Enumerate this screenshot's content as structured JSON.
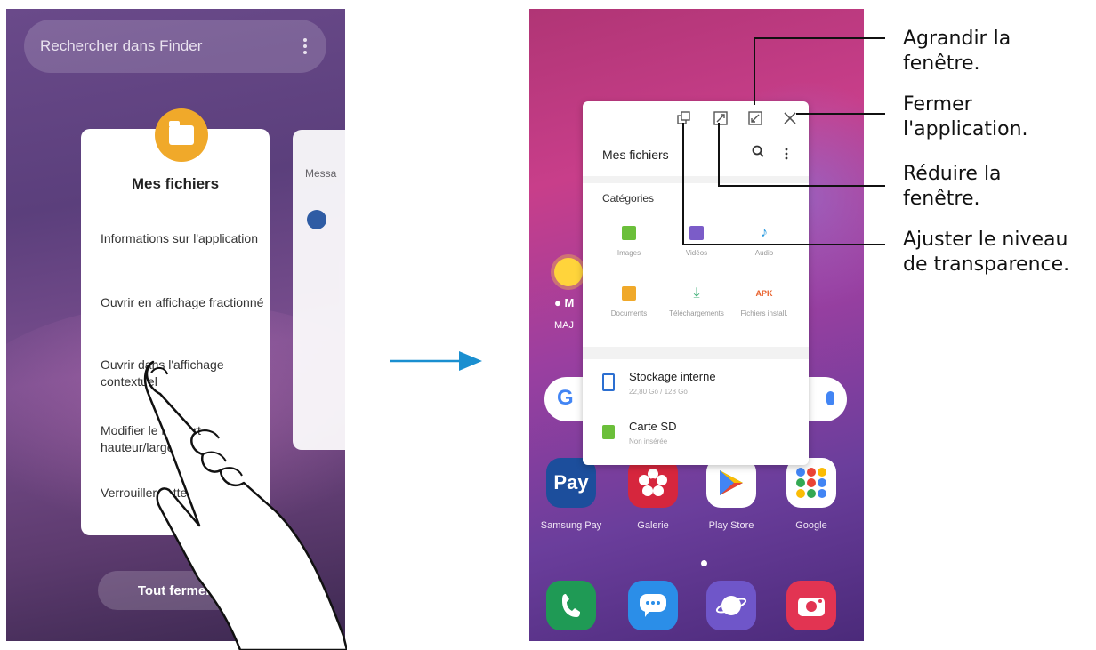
{
  "left_screen": {
    "search_placeholder": "Rechercher dans Finder",
    "card_title": "Mes fichiers",
    "menu_items": [
      "Informations sur l'application",
      "Ouvrir en affichage fractionné",
      "Ouvrir dans l'affichage contextuel",
      "Modifier le rapport hauteur/largeur",
      "Verrouiller cette app"
    ],
    "second_card_label": "Messa",
    "close_all_label": "Tout fermer"
  },
  "right_screen": {
    "popup": {
      "title": "Mes fichiers",
      "categories_title": "Catégories",
      "categories": [
        {
          "label": "Images",
          "icon": "image-icon",
          "color": "#6bbf3a"
        },
        {
          "label": "Vidéos",
          "icon": "video-icon",
          "color": "#7b5cc8"
        },
        {
          "label": "Audio",
          "icon": "music-icon",
          "color": "#2c9be0"
        },
        {
          "label": "Documents",
          "icon": "document-icon",
          "color": "#f0a92a"
        },
        {
          "label": "Téléchargements",
          "icon": "download-icon",
          "color": "#3bae74"
        },
        {
          "label": "Fichiers install.",
          "icon": "apk-icon",
          "color": "#e8612c"
        }
      ],
      "apk_text": "APK",
      "storage": [
        {
          "name": "Stockage interne",
          "sub": "22,80 Go / 128 Go"
        },
        {
          "name": "Carte SD",
          "sub": "Non insérée"
        }
      ]
    },
    "weather_loc": "M",
    "weather_update": "MAJ",
    "google_letter": "G",
    "apps": [
      {
        "label": "Samsung Pay",
        "text": "Pay",
        "color": "#1c4e9c"
      },
      {
        "label": "Galerie",
        "text": "",
        "color": "#d6263d"
      },
      {
        "label": "Play Store",
        "text": "",
        "color": "#ffffff"
      },
      {
        "label": "Google",
        "text": "",
        "color": "#ffffff"
      }
    ],
    "dock": [
      {
        "name": "phone",
        "color": "#1f9a55"
      },
      {
        "name": "messages",
        "color": "#2b8ee8"
      },
      {
        "name": "internet",
        "color": "#6f56c9"
      },
      {
        "name": "camera",
        "color": "#e23452"
      }
    ]
  },
  "callouts": {
    "maximize": "Agrandir la fenêtre.",
    "close": "Fermer l'application.",
    "minimize": "Réduire la fenêtre.",
    "transparency": "Ajuster le niveau de transparence."
  }
}
